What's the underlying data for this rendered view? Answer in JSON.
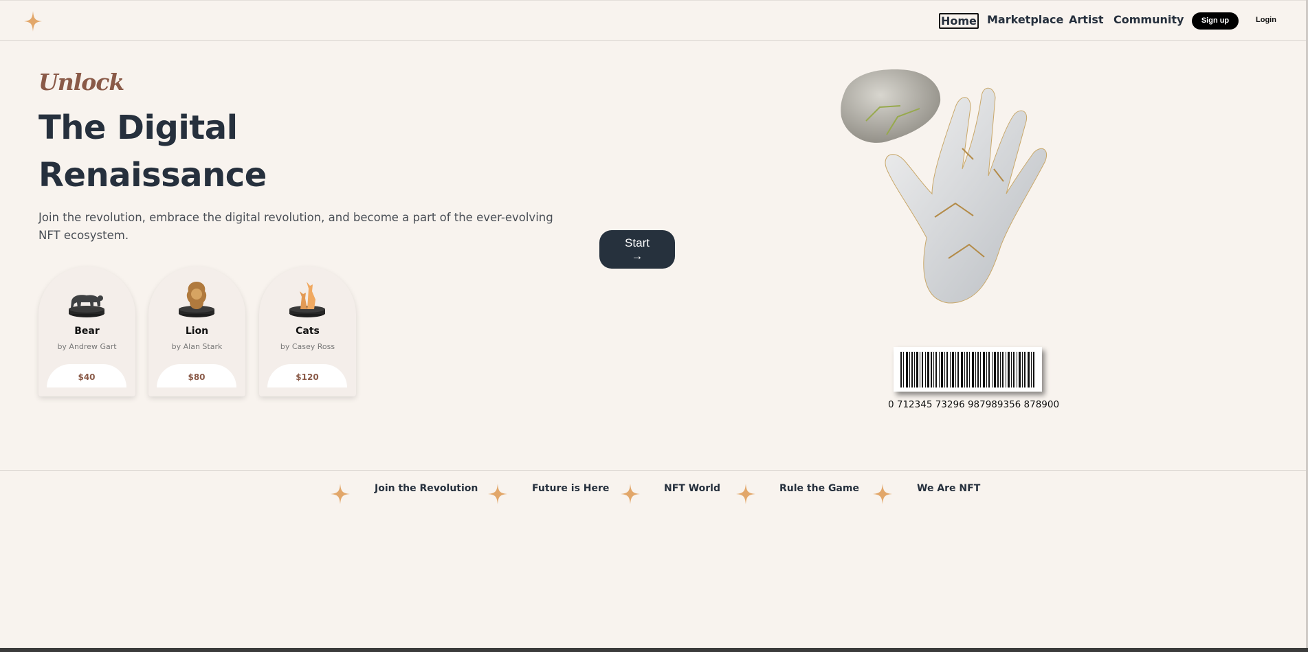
{
  "nav": {
    "links": [
      "Home",
      "Marketplace",
      "Artist",
      "Community"
    ],
    "signup_label": "Sign up",
    "login_label": "Login"
  },
  "hero": {
    "kicker": "Unlock",
    "title_line1": "The Digital",
    "title_line2": "Renaissance",
    "description": "Join the revolution, embrace the digital revolution, and become a part of the ever-evolving NFT ecosystem.",
    "start_label": "Start",
    "start_arrow": "→"
  },
  "cards": [
    {
      "title": "Bear",
      "artist": "by Andrew Gart",
      "price": "$40",
      "icon": "bear-statue-icon"
    },
    {
      "title": "Lion",
      "artist": "by Alan Stark",
      "price": "$80",
      "icon": "lion-statue-icon"
    },
    {
      "title": "Cats",
      "artist": "by Casey Ross",
      "price": "$120",
      "icon": "cats-statue-icon"
    }
  ],
  "barcode": {
    "number": "0 712345 73296 987989356 878900"
  },
  "ticker": [
    "Join the Revolution",
    "Future is Here",
    "NFT World",
    "Rule the Game",
    "We Are NFT"
  ],
  "colors": {
    "accent": "#8a5a48",
    "dark": "#26303d",
    "background": "#f8f3ee",
    "star": "#e2a76a"
  }
}
